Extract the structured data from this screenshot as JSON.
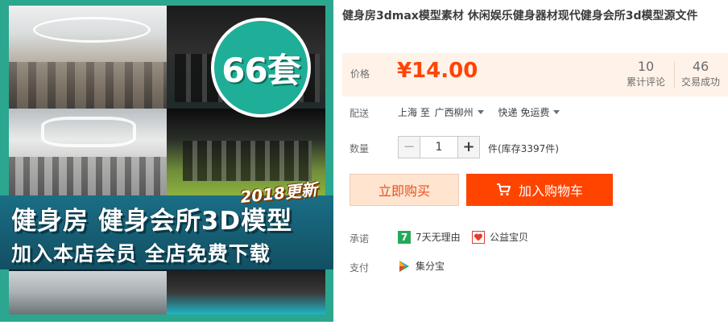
{
  "product_image": {
    "set_count": "66套",
    "update_badge": "2018更新",
    "banner_line_1": "健身房  健身会所3D模型",
    "banner_line_2": "加入本店会员  全店免费下载"
  },
  "product": {
    "title": "健身房3dmax模型素材 休闲娱乐健身器材现代健身会所3d模型源文件"
  },
  "price": {
    "label": "价格",
    "value": "¥14.00",
    "reviews_count": "10",
    "reviews_label": "累计评论",
    "sales_count": "46",
    "sales_label": "交易成功"
  },
  "shipping": {
    "label": "配送",
    "from": "上海 至",
    "destination": "广西柳州",
    "method": "快递 免运费"
  },
  "quantity": {
    "label": "数量",
    "minus": "−",
    "value": "1",
    "plus": "+",
    "stock": "件(库存3397件)"
  },
  "actions": {
    "buy_now": "立即购买",
    "add_to_cart": "加入购物车"
  },
  "promise": {
    "label": "承诺",
    "items": [
      {
        "icon": "seven-day-return-icon",
        "icon_text": "7",
        "text": "7天无理由"
      },
      {
        "icon": "charity-icon",
        "text": "公益宝贝"
      }
    ]
  },
  "payment": {
    "label": "支付",
    "items": [
      {
        "icon": "jifenbao-icon",
        "text": "集分宝"
      }
    ]
  },
  "colors": {
    "accent": "#ff4400",
    "price": "#ff4400",
    "price_bg": "#fff2e8",
    "image_frame": "#2ba68f"
  }
}
